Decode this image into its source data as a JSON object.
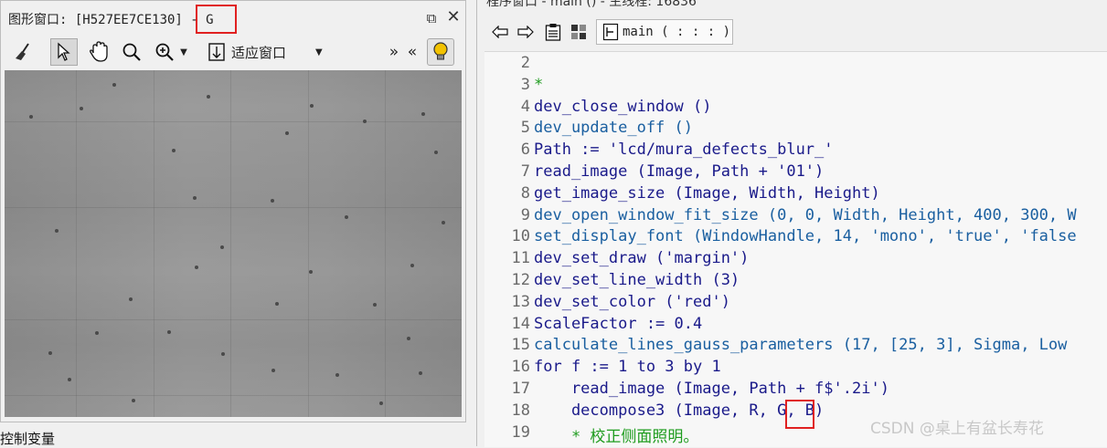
{
  "graphics_window": {
    "title": "图形窗口: [H527EE7CE130] - G",
    "restore_glyph": "⧉",
    "close_glyph": "✕",
    "toolbar": {
      "tools": [
        "broom-icon",
        "pointer-icon",
        "hand-icon",
        "zoom-icon",
        "zoom-plus-icon"
      ],
      "zoom_mode": "适应窗口",
      "nav_right": "»",
      "nav_left": "«"
    }
  },
  "bottom_panel_label": "控制变量",
  "program_window": {
    "title_partial": "程序窗口 - main () - 主线程: 16836",
    "procedure_select": "main ( : : : )",
    "code_lines": [
      {
        "n": "2",
        "text": "",
        "kind": "plain"
      },
      {
        "n": "3",
        "text": "*",
        "kind": "comment"
      },
      {
        "n": "4",
        "text": "dev_close_window ()",
        "kind": "op"
      },
      {
        "n": "5",
        "text": "dev_update_off ()",
        "kind": "proc"
      },
      {
        "n": "6",
        "text": "Path := 'lcd/mura_defects_blur_'",
        "kind": "op"
      },
      {
        "n": "7",
        "text": "read_image (Image, Path + '01')",
        "kind": "op"
      },
      {
        "n": "8",
        "text": "get_image_size (Image, Width, Height)",
        "kind": "op"
      },
      {
        "n": "9",
        "text": "dev_open_window_fit_size (0, 0, Width, Height, 400, 300, W",
        "kind": "proc"
      },
      {
        "n": "10",
        "text": "set_display_font (WindowHandle, 14, 'mono', 'true', 'false",
        "kind": "proc"
      },
      {
        "n": "11",
        "text": "dev_set_draw ('margin')",
        "kind": "op"
      },
      {
        "n": "12",
        "text": "dev_set_line_width (3)",
        "kind": "op"
      },
      {
        "n": "13",
        "text": "dev_set_color ('red')",
        "kind": "op"
      },
      {
        "n": "14",
        "text": "ScaleFactor := 0.4",
        "kind": "op"
      },
      {
        "n": "15",
        "text": "calculate_lines_gauss_parameters (17, [25, 3], Sigma, Low",
        "kind": "proc"
      },
      {
        "n": "16",
        "text": "for f := 1 to 3 by 1",
        "kind": "ctrl"
      },
      {
        "n": "17",
        "text": "    read_image (Image, Path + f$'.2i')",
        "kind": "op"
      },
      {
        "n": "18",
        "text": "    decompose3 (Image, R, G, B)",
        "kind": "op"
      },
      {
        "n": "19",
        "text": "    * 校正侧面照明。",
        "kind": "comment"
      }
    ]
  },
  "watermark": "CSDN @桌上有盆长寿花",
  "colors": {
    "highlight_box": "#e02020",
    "comment": "#1e9c1e",
    "operator": "#1a1a8a",
    "procedure": "#1a5fa0"
  }
}
